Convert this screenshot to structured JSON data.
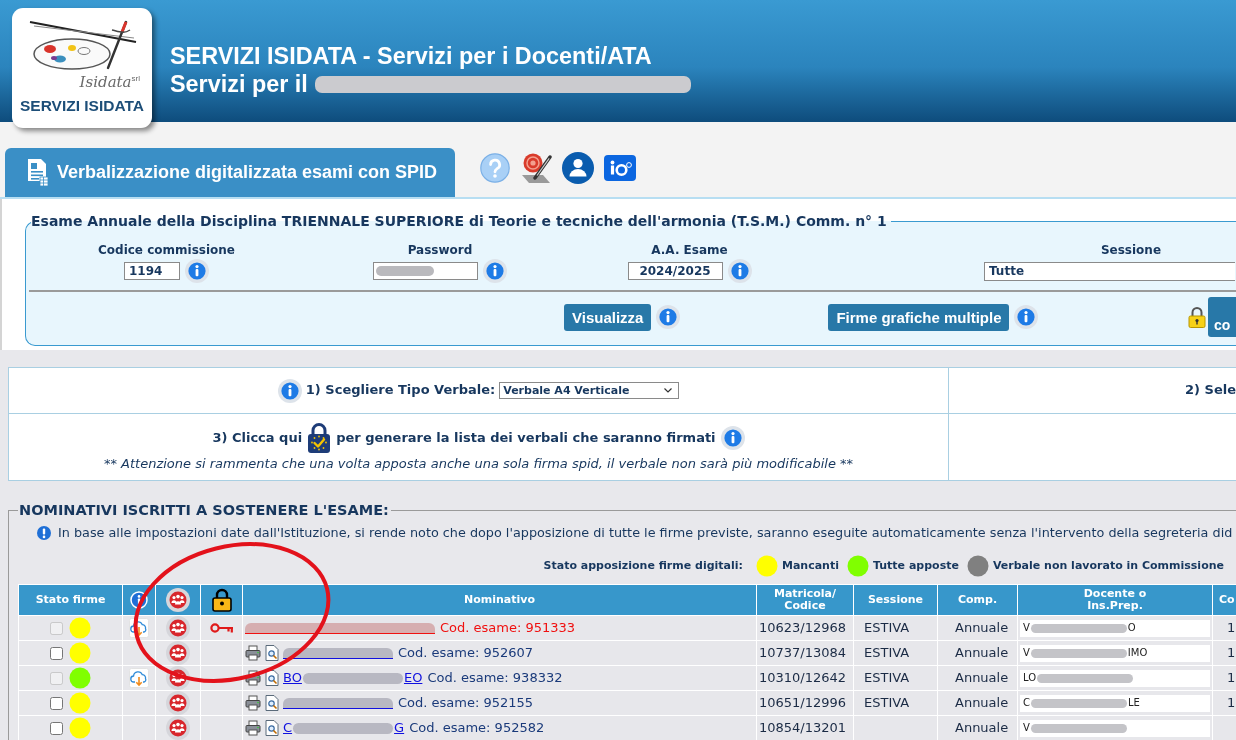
{
  "header": {
    "logo": {
      "wordmark": "Isidata",
      "suffix": "srl",
      "caption": "SERVIZI ISIDATA"
    },
    "title": "SERVIZI ISIDATA - Servizi per i Docenti/ATA",
    "subtitle": "Servizi per il"
  },
  "tabs": [
    {
      "label": "Verbalizzazione digitalizzata esami con SPID",
      "selected": true
    }
  ],
  "toolbar_icons": [
    {
      "kind": "help"
    },
    {
      "kind": "seal"
    },
    {
      "kind": "user"
    },
    {
      "kind": "app"
    }
  ],
  "exam": {
    "title": "Esame Annuale della Disciplina TRIENNALE SUPERIORE di Teorie e tecniche dell'armonia (T.S.M.) Comm. n° 1",
    "fields": [
      {
        "kind": "text",
        "label": "Codice commissione",
        "value": "1194",
        "info": true
      },
      {
        "kind": "secret",
        "label": "Password",
        "info": true
      },
      {
        "kind": "text",
        "label": "A.A. Esame",
        "value": "2024/2025",
        "info": true
      },
      {
        "kind": "select",
        "label": "Sessione",
        "value": "Tutte",
        "info": false
      }
    ],
    "actions": [
      {
        "kind": "button",
        "label": "Visualizza",
        "info": true
      },
      {
        "kind": "button",
        "label": "Firme grafiche multiple",
        "info": true
      },
      {
        "kind": "locked",
        "label": "co",
        "info": false
      }
    ]
  },
  "steps": {
    "step1": {
      "label": "1) Scegliere Tipo Verbale:",
      "value": "Verbale A4 Verticale"
    },
    "step2": {
      "label": "2) Sele"
    },
    "step3": {
      "before": "3) Clicca qui",
      "after": "per generare la lista dei verbali che saranno firmati"
    },
    "warning": "** Attenzione si rammenta che una volta apposta anche una sola firma spid, il verbale non sarà più modificabile **"
  },
  "students": {
    "title": "NOMINATIVI ISCRITTI A SOSTENERE L'ESAME:",
    "notice": "In base alle impostazioni date dall'Istituzione, si rende noto che dopo l'apposizione di tutte le firme previste, saranno eseguite automaticamente senza l'intervento della segreteria did",
    "legend": {
      "label": "Stato apposizione firme digitali:",
      "items": [
        {
          "label": "Mancanti",
          "color": "#ffff00"
        },
        {
          "label": "Tutte apposte",
          "color": "#80ff00"
        },
        {
          "label": "Verbale non lavorato in Commissione",
          "color": "#808080"
        }
      ]
    },
    "table": {
      "columns": [
        {
          "kind": "text",
          "lines": [
            "Stato firme"
          ]
        },
        {
          "kind": "info"
        },
        {
          "kind": "group"
        },
        {
          "kind": "lock"
        },
        {
          "kind": "text",
          "lines": [
            "Nominativo"
          ]
        },
        {
          "kind": "text",
          "lines": [
            "Matricola/",
            "Codice"
          ]
        },
        {
          "kind": "text",
          "lines": [
            "Sessione"
          ]
        },
        {
          "kind": "text",
          "lines": [
            "Comp."
          ]
        },
        {
          "kind": "text",
          "lines": [
            "Docente o",
            "Ins.Prep."
          ]
        },
        {
          "kind": "text",
          "lines": [
            "Co"
          ]
        }
      ],
      "rows": [
        {
          "checked": false,
          "disabled": true,
          "color": "#ffff00",
          "download": true,
          "key": true,
          "documents": false,
          "assigned": true,
          "code": "Cod. esame: 951333",
          "matricola": "10623/12968",
          "session": "ESTIVA",
          "comp": "Annuale",
          "teacher_start": "V",
          "teacher_end": "O",
          "column_10": "1"
        },
        {
          "checked": false,
          "disabled": false,
          "color": "#ffff00",
          "download": false,
          "key": false,
          "documents": true,
          "assigned": false,
          "code": "Cod. esame: 952607",
          "matricola": "10737/13084",
          "session": "ESTIVA",
          "comp": "Annuale",
          "teacher_start": "V",
          "teacher_end": "IMO",
          "column_10": "1"
        },
        {
          "checked": false,
          "disabled": true,
          "color": "#80ff00",
          "download": true,
          "key": false,
          "documents": true,
          "assigned": false,
          "name_start": "BO",
          "name_end": "EO",
          "code": "Cod. esame: 938332",
          "matricola": "10310/12642",
          "session": "ESTIVA",
          "comp": "Annuale",
          "teacher_start": "LO",
          "column_10": "1"
        },
        {
          "checked": false,
          "disabled": false,
          "color": "#ffff00",
          "download": false,
          "key": false,
          "documents": true,
          "assigned": false,
          "code": "Cod. esame: 952155",
          "matricola": "10651/12996",
          "session": "ESTIVA",
          "comp": "Annuale",
          "teacher_start": "C",
          "teacher_end": "LE",
          "column_10": "1"
        },
        {
          "checked": false,
          "disabled": false,
          "color": "#ffff00",
          "download": false,
          "key": false,
          "documents": true,
          "assigned": false,
          "name_start": "C",
          "name_end": "G",
          "code": "Cod. esame: 952582",
          "matricola": "10854/13201",
          "comp": "Annuale",
          "teacher_start": "V"
        }
      ]
    }
  },
  "annotation": {
    "kind": "circle"
  }
}
